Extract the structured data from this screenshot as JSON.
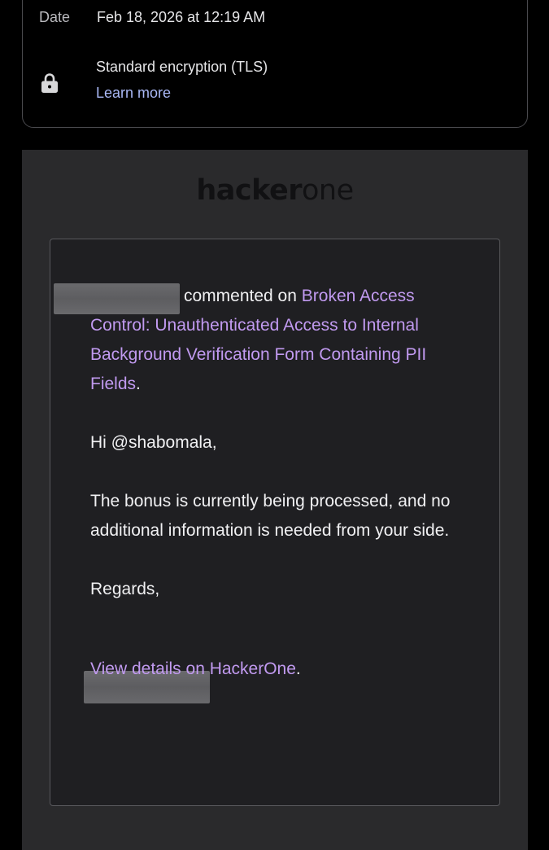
{
  "details": {
    "date_label": "Date",
    "date_value": "Feb 18, 2026 at 12:19 AM",
    "encryption": "Standard encryption (TLS)",
    "learn_more": "Learn more"
  },
  "brand": {
    "logo_bold": "hacker",
    "logo_thin": "one"
  },
  "email": {
    "commented_on": "commented on",
    "report_title": "Broken Access Control: Unauthenticated Access to Internal Background Verification Form Containing PII Fields",
    "period": ".",
    "greeting": "Hi @shabomala,",
    "message": "The bonus is currently being processed, and no additional information is needed from your side.",
    "regards": "Regards,",
    "view_details": "View details on HackerOne",
    "view_details_period": "."
  },
  "colors": {
    "link": "#c19af0",
    "learn_more": "#a9b8f5",
    "card_bg": "#1f1f22",
    "body_bg": "#2a2a2c"
  }
}
